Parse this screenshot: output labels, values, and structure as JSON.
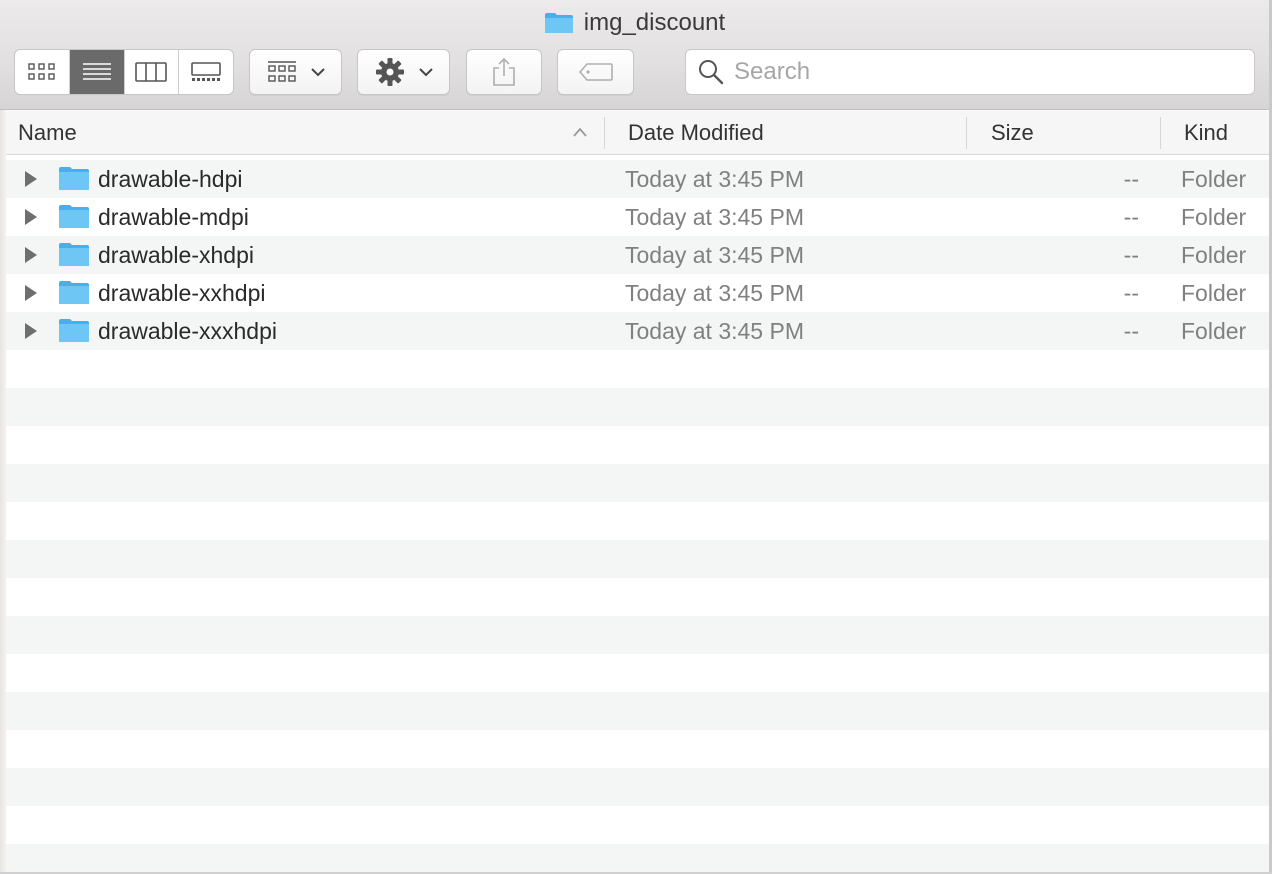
{
  "window": {
    "title": "img_discount",
    "title_icon": "folder-icon"
  },
  "toolbar": {
    "view_buttons": [
      {
        "name": "icon-view",
        "icon": "grid-icon",
        "active": false
      },
      {
        "name": "list-view",
        "icon": "list-icon",
        "active": true
      },
      {
        "name": "column-view",
        "icon": "columns-icon",
        "active": false
      },
      {
        "name": "gallery-view",
        "icon": "gallery-icon",
        "active": false
      }
    ],
    "group_button_icon": "group-grid-icon",
    "action_button_icon": "gear-icon",
    "share_button_icon": "share-icon",
    "tags_button_icon": "tag-icon",
    "search": {
      "placeholder": "Search",
      "value": ""
    }
  },
  "columns": {
    "name": "Name",
    "date_modified": "Date Modified",
    "size": "Size",
    "kind": "Kind",
    "sort_column": "Name",
    "sort_direction": "ascending"
  },
  "rows": [
    {
      "name": "drawable-hdpi",
      "date_modified": "Today at 3:45 PM",
      "size": "--",
      "kind": "Folder"
    },
    {
      "name": "drawable-mdpi",
      "date_modified": "Today at 3:45 PM",
      "size": "--",
      "kind": "Folder"
    },
    {
      "name": "drawable-xhdpi",
      "date_modified": "Today at 3:45 PM",
      "size": "--",
      "kind": "Folder"
    },
    {
      "name": "drawable-xxhdpi",
      "date_modified": "Today at 3:45 PM",
      "size": "--",
      "kind": "Folder"
    },
    {
      "name": "drawable-xxxhdpi",
      "date_modified": "Today at 3:45 PM",
      "size": "--",
      "kind": "Folder"
    }
  ],
  "colors": {
    "folder_blue": "#6ec6f5",
    "folder_blue_dark": "#4aaee8",
    "stripe": "#f4f5f5",
    "active_segment": "#6a6a6a"
  }
}
